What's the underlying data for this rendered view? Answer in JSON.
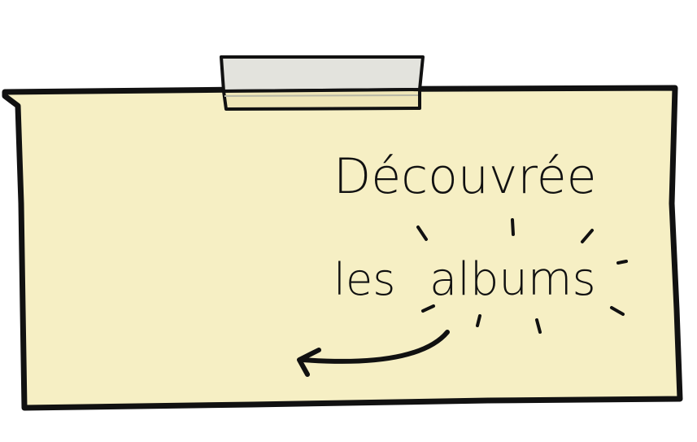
{
  "note": {
    "line1": "Découvrée",
    "line2_prefix": "les",
    "line2_highlight": "albums"
  },
  "colors": {
    "paper": "#f6efc4",
    "ink": "#111111",
    "tape": "#e3e3dd",
    "tape_overlap": "#efe6b8"
  },
  "icons": {
    "arrow": "curved-arrow-left-icon",
    "sparkle": "sparkle-rays-icon",
    "tape": "tape-strip-icon"
  }
}
